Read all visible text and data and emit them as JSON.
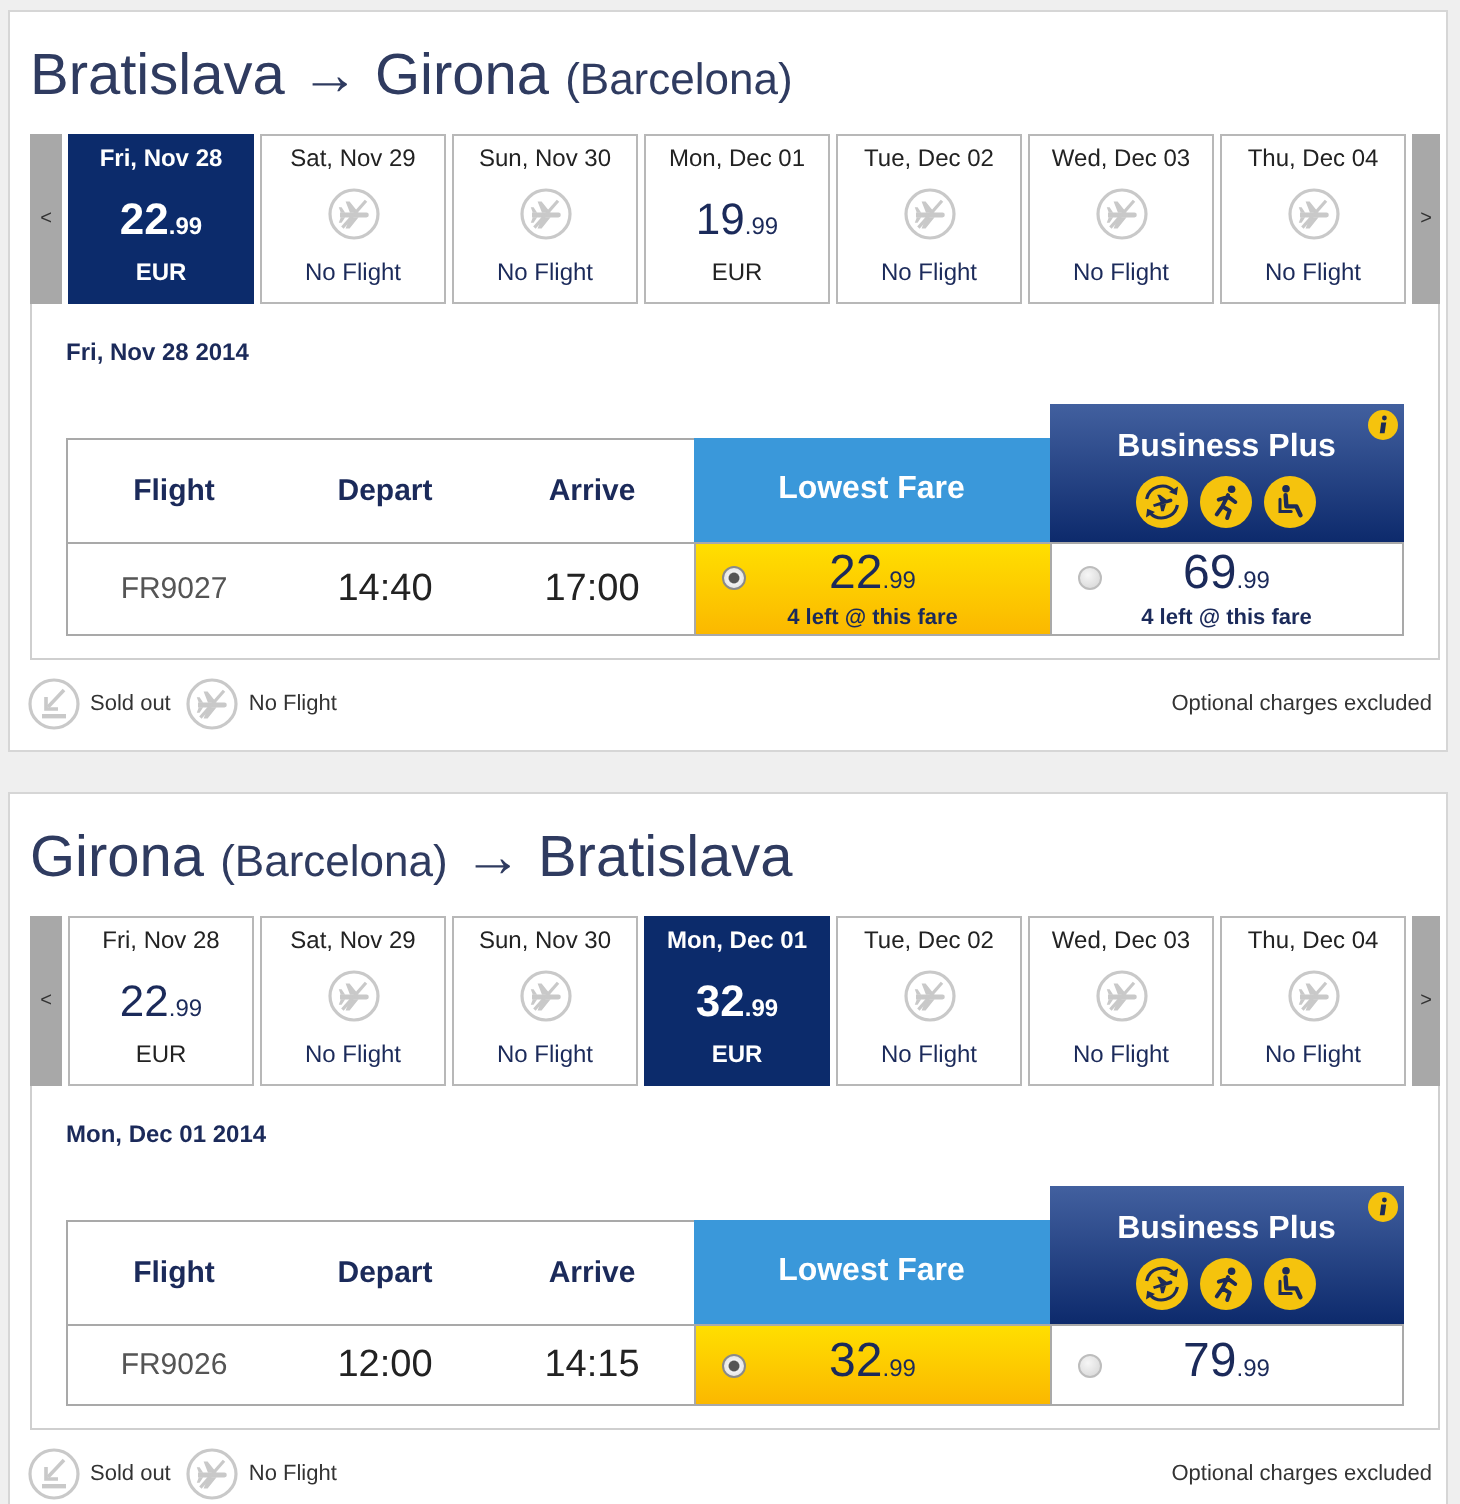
{
  "journeys": [
    {
      "title": [
        {
          "kind": "city",
          "text": "Bratislava"
        },
        {
          "kind": "arrow",
          "text": "→"
        },
        {
          "kind": "city",
          "text": "Girona"
        },
        {
          "kind": "note",
          "text": "(Barcelona)"
        }
      ],
      "prev_button": "<",
      "next_button": ">",
      "dates": [
        {
          "kind": "fare",
          "label": "Fri, Nov 28",
          "amount": "22",
          "decimals": ".99",
          "currency": "EUR",
          "selected": true
        },
        {
          "kind": "no_flight",
          "label": "Sat, Nov 29",
          "status": "No Flight",
          "selected": false
        },
        {
          "kind": "no_flight",
          "label": "Sun, Nov 30",
          "status": "No Flight",
          "selected": false
        },
        {
          "kind": "fare",
          "label": "Mon, Dec 01",
          "amount": "19",
          "decimals": ".99",
          "currency": "EUR",
          "selected": false
        },
        {
          "kind": "no_flight",
          "label": "Tue, Dec 02",
          "status": "No Flight",
          "selected": false
        },
        {
          "kind": "no_flight",
          "label": "Wed, Dec 03",
          "status": "No Flight",
          "selected": false
        },
        {
          "kind": "no_flight",
          "label": "Thu, Dec 04",
          "status": "No Flight",
          "selected": false
        }
      ],
      "selected_date": "Fri, Nov 28 2014",
      "columns": [
        "Flight",
        "Depart",
        "Arrive"
      ],
      "fare_classes": [
        {
          "kind": "lowest",
          "label": "Lowest Fare"
        },
        {
          "kind": "business",
          "label": "Business Plus"
        }
      ],
      "rows": [
        {
          "flight": "FR9027",
          "depart": "14:40",
          "arrive": "17:00",
          "fares": [
            {
              "amount": "22",
              "decimals": ".99",
              "note": "4 left @ this fare",
              "selected": true
            },
            {
              "amount": "69",
              "decimals": ".99",
              "note": "4 left @ this fare",
              "selected": false
            }
          ]
        }
      ],
      "legend": [
        {
          "kind": "sold_out",
          "label": "Sold out"
        },
        {
          "kind": "no_flight",
          "label": "No Flight"
        }
      ],
      "footnote": "Optional charges excluded"
    },
    {
      "title": [
        {
          "kind": "city",
          "text": "Girona"
        },
        {
          "kind": "note",
          "text": "(Barcelona)"
        },
        {
          "kind": "arrow",
          "text": "→"
        },
        {
          "kind": "city",
          "text": "Bratislava"
        }
      ],
      "prev_button": "<",
      "next_button": ">",
      "dates": [
        {
          "kind": "fare",
          "label": "Fri, Nov 28",
          "amount": "22",
          "decimals": ".99",
          "currency": "EUR",
          "selected": false
        },
        {
          "kind": "no_flight",
          "label": "Sat, Nov 29",
          "status": "No Flight",
          "selected": false
        },
        {
          "kind": "no_flight",
          "label": "Sun, Nov 30",
          "status": "No Flight",
          "selected": false
        },
        {
          "kind": "fare",
          "label": "Mon, Dec 01",
          "amount": "32",
          "decimals": ".99",
          "currency": "EUR",
          "selected": true
        },
        {
          "kind": "no_flight",
          "label": "Tue, Dec 02",
          "status": "No Flight",
          "selected": false
        },
        {
          "kind": "no_flight",
          "label": "Wed, Dec 03",
          "status": "No Flight",
          "selected": false
        },
        {
          "kind": "no_flight",
          "label": "Thu, Dec 04",
          "status": "No Flight",
          "selected": false
        }
      ],
      "selected_date": "Mon, Dec 01 2014",
      "columns": [
        "Flight",
        "Depart",
        "Arrive"
      ],
      "fare_classes": [
        {
          "kind": "lowest",
          "label": "Lowest Fare"
        },
        {
          "kind": "business",
          "label": "Business Plus"
        }
      ],
      "rows": [
        {
          "flight": "FR9026",
          "depart": "12:00",
          "arrive": "14:15",
          "fares": [
            {
              "amount": "32",
              "decimals": ".99",
              "selected": true
            },
            {
              "amount": "79",
              "decimals": ".99",
              "selected": false
            }
          ]
        }
      ],
      "legend": [
        {
          "kind": "sold_out",
          "label": "Sold out"
        },
        {
          "kind": "no_flight",
          "label": "No Flight"
        }
      ],
      "footnote": "Optional charges excluded"
    }
  ]
}
